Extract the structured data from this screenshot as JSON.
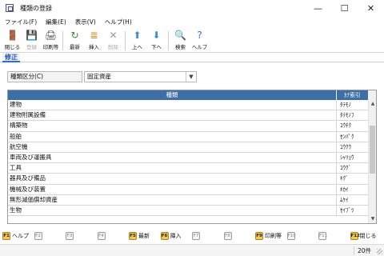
{
  "window": {
    "title": "種類の登録",
    "min": "—",
    "max": "☐",
    "close": "✕"
  },
  "menu": [
    "ファイル(F)",
    "編集(E)",
    "表示(V)",
    "ヘルプ(H)"
  ],
  "toolbar": [
    {
      "label": "閉じる",
      "icon": "close-door-icon",
      "glyph": "🚪",
      "enabled": true,
      "color": "#c0392b"
    },
    {
      "label": "登録",
      "icon": "save-icon",
      "glyph": "💾",
      "enabled": false,
      "color": "#999999"
    },
    {
      "label": "印刷等",
      "icon": "print-icon",
      "glyph": "🖨",
      "enabled": true,
      "color": "#555555"
    },
    {
      "label": "最新",
      "icon": "refresh-icon",
      "glyph": "↻",
      "enabled": true,
      "color": "#2e8b3a"
    },
    {
      "label": "挿入",
      "icon": "insert-icon",
      "glyph": "≣",
      "enabled": true,
      "color": "#d08a1e"
    },
    {
      "label": "削除",
      "icon": "delete-icon",
      "glyph": "✕",
      "enabled": false,
      "color": "#999999"
    },
    {
      "label": "上へ",
      "icon": "arrow-up-icon",
      "glyph": "⬆",
      "enabled": true,
      "color": "#3a8fd8"
    },
    {
      "label": "下へ",
      "icon": "arrow-down-icon",
      "glyph": "⬇",
      "enabled": true,
      "color": "#3a8fd8"
    },
    {
      "label": "検索",
      "icon": "search-icon",
      "glyph": "🔍",
      "enabled": true,
      "color": "#444444"
    },
    {
      "label": "ヘルプ",
      "icon": "help-icon",
      "glyph": "?",
      "enabled": true,
      "color": "#3a6fd8"
    }
  ],
  "mode": "修正",
  "field": {
    "label": "種類区分(C)",
    "value": "固定資産"
  },
  "grid": {
    "headers": {
      "name": "種類",
      "kana": "ｶﾅ索引"
    },
    "rows": [
      {
        "name": "建物",
        "kana": "ﾀﾃﾓﾉ"
      },
      {
        "name": "建物附属設備",
        "kana": "ﾀﾃﾓﾉﾌ"
      },
      {
        "name": "構築物",
        "kana": "ｺｳﾁｸ"
      },
      {
        "name": "船舶",
        "kana": "ｾﾝﾊﾟｸ"
      },
      {
        "name": "航空機",
        "kana": "ｺｳｸｳ"
      },
      {
        "name": "車両及び運搬具",
        "kana": "ｼｬﾘｮｳ"
      },
      {
        "name": "工具",
        "kana": "ｺｳｸﾞ"
      },
      {
        "name": "器具及び備品",
        "kana": "ｷｸﾞ"
      },
      {
        "name": "機械及び装置",
        "kana": "ｷｶｲ"
      },
      {
        "name": "無形減価償却資産",
        "kana": "ﾑｹｲ"
      },
      {
        "name": "生物",
        "kana": "ｾｲﾌﾞﾂ"
      }
    ]
  },
  "fkeys": [
    {
      "key": "F1",
      "label": "ヘルプ",
      "active": true
    },
    {
      "key": "F2",
      "label": "",
      "active": false
    },
    {
      "key": "F3",
      "label": "",
      "active": false
    },
    {
      "key": "F4",
      "label": "",
      "active": false
    },
    {
      "key": "F5",
      "label": "最新",
      "active": true
    },
    {
      "key": "F6",
      "label": "挿入",
      "active": true
    },
    {
      "key": "F7",
      "label": "",
      "active": false
    },
    {
      "key": "F8",
      "label": "",
      "active": false
    },
    {
      "key": "F9",
      "label": "印刷等",
      "active": true
    },
    {
      "key": "F10",
      "label": "",
      "active": false
    },
    {
      "key": "F11",
      "label": "",
      "active": false
    },
    {
      "key": "F12",
      "label": "閉じる",
      "active": true
    }
  ],
  "status": {
    "count": "20件"
  }
}
